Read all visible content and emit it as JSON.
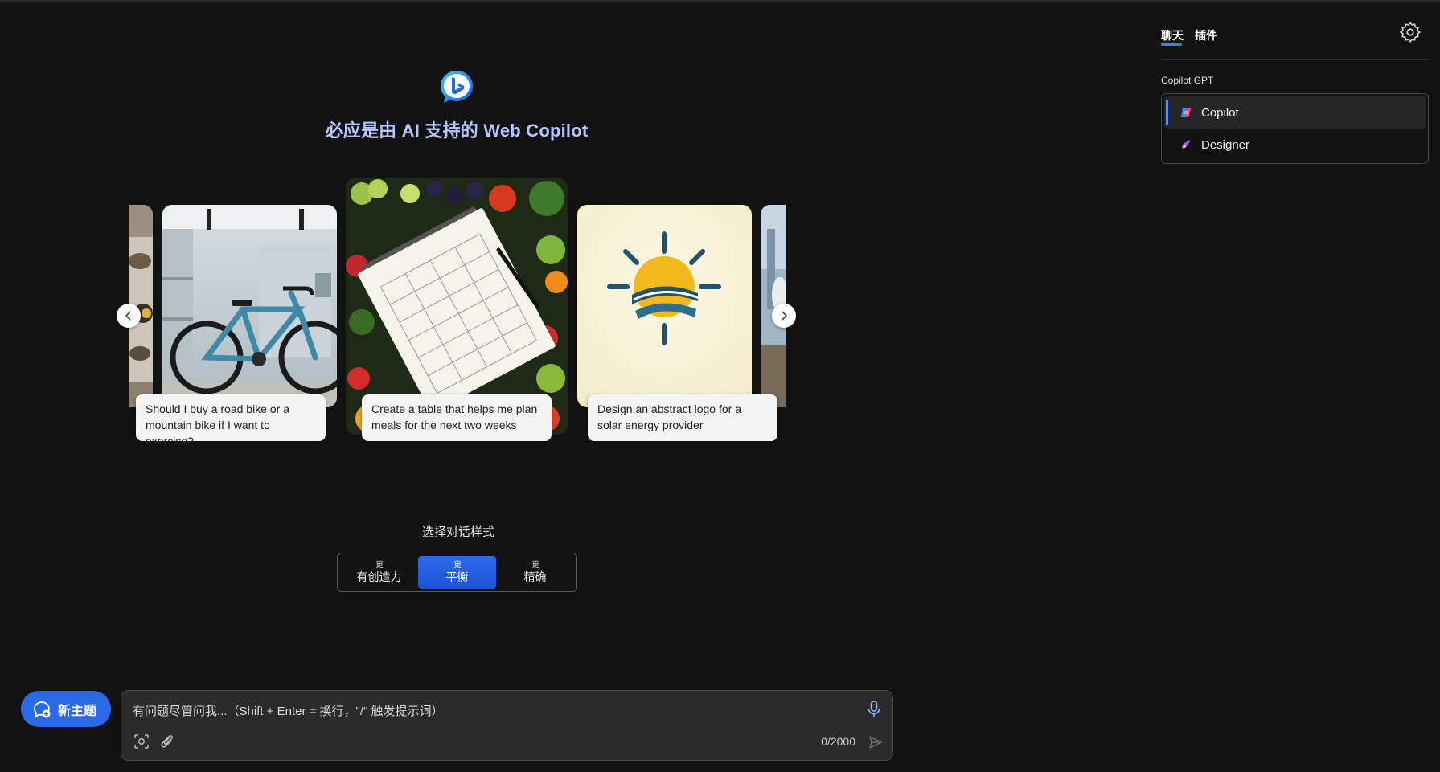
{
  "header": {
    "title": "必应是由 AI 支持的 Web Copilot",
    "logo_icon": "bing-chat-logo-icon"
  },
  "carousel": {
    "prev_icon": "chevron-left-icon",
    "next_icon": "chevron-right-icon",
    "cards": [
      {
        "image": "road-bike-in-shop",
        "caption": "Should I buy a road bike or a mountain bike if I want to exercise?"
      },
      {
        "image": "meal-plan-notebook-with-produce",
        "caption": "Create a table that helps me plan meals for the next two weeks"
      },
      {
        "image": "solar-energy-logo",
        "caption": "Design an abstract logo for a solar energy provider"
      }
    ]
  },
  "tone": {
    "title": "选择对话样式",
    "options": [
      {
        "more": "更",
        "label": "有创造力",
        "active": false
      },
      {
        "more": "更",
        "label": "平衡",
        "active": true
      },
      {
        "more": "更",
        "label": "精确",
        "active": false
      }
    ]
  },
  "new_topic": {
    "label": "新主题",
    "icon": "new-chat-icon"
  },
  "input": {
    "placeholder": "有问题尽管问我...（Shift + Enter = 换行，\"/\" 触发提示词）",
    "counter": "0/2000",
    "mic_icon": "microphone-icon",
    "screenshot_icon": "screenshot-icon",
    "attach_icon": "paperclip-icon",
    "send_icon": "send-icon"
  },
  "right_panel": {
    "tabs": [
      {
        "label": "聊天",
        "active": true
      },
      {
        "label": "插件",
        "active": false
      }
    ],
    "settings_icon": "gear-icon",
    "section_title": "Copilot GPT",
    "gpts": [
      {
        "label": "Copilot",
        "active": true
      },
      {
        "label": "Designer",
        "active": false
      }
    ]
  },
  "colors": {
    "background": "#121212",
    "accent": "#2a6ae8",
    "title": "#b6c6ff"
  }
}
